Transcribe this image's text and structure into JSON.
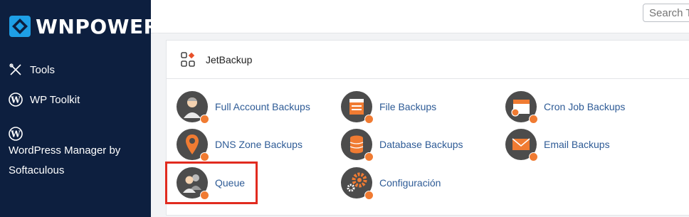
{
  "sidebar": {
    "brand": "WNPOWER",
    "items": [
      {
        "label": "Tools",
        "icon": "tools-icon"
      },
      {
        "label": "WP Toolkit",
        "icon": "wordpress-icon"
      },
      {
        "label": "WordPress Manager by Softaculous",
        "icon": "wordpress-icon"
      }
    ]
  },
  "topbar": {
    "search_placeholder": "Search T"
  },
  "section": {
    "title": "JetBackup",
    "items": [
      {
        "label": "Full Account Backups",
        "icon": "full-account-backups-icon"
      },
      {
        "label": "File Backups",
        "icon": "file-backups-icon"
      },
      {
        "label": "Cron Job Backups",
        "icon": "cron-job-backups-icon"
      },
      {
        "label": "DNS Zone Backups",
        "icon": "dns-zone-backups-icon"
      },
      {
        "label": "Database Backups",
        "icon": "database-backups-icon"
      },
      {
        "label": "Email Backups",
        "icon": "email-backups-icon"
      },
      {
        "label": "Queue",
        "icon": "queue-icon"
      },
      {
        "label": "Configuración",
        "icon": "configuration-icon"
      }
    ]
  },
  "colors": {
    "sidebar_bg": "#0d1f3f",
    "link": "#2e5b96",
    "accent": "#f07b32",
    "highlight": "#e12b1f"
  }
}
